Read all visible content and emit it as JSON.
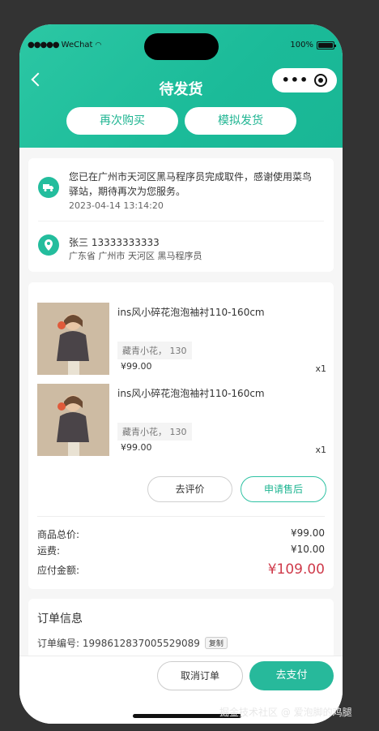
{
  "status_bar": {
    "carrier": "WeChat",
    "battery": "100%"
  },
  "nav": {
    "title": "待发货"
  },
  "header_buttons": {
    "rebuy": "再次购买",
    "mock_ship": "模拟发货"
  },
  "shipping": {
    "message": "您已在广州市天河区黑马程序员完成取件，感谢使用菜鸟驿站，期待再次为您服务。",
    "time": "2023-04-14 13:14:20"
  },
  "address": {
    "name_phone": "张三 13333333333",
    "detail": "广东省 广州市 天河区 黑马程序员"
  },
  "goods": [
    {
      "title": "ins风小碎花泡泡袖衬110-160cm",
      "spec": "藏青小花， 130",
      "price": "¥99.00",
      "qty": "x1"
    },
    {
      "title": "ins风小碎花泡泡袖衬110-160cm",
      "spec": "藏青小花， 130",
      "price": "¥99.00",
      "qty": "x1"
    }
  ],
  "goods_actions": {
    "review": "去评价",
    "after_sale": "申请售后"
  },
  "summary": {
    "goods_total_label": "商品总价:",
    "goods_total": "¥99.00",
    "freight_label": "运费:",
    "freight": "¥10.00",
    "payable_label": "应付金额:",
    "payable": "¥109.00"
  },
  "order": {
    "title": "订单信息",
    "number": "订单编号: 1998612837005529089",
    "copy": "复制"
  },
  "bottom": {
    "cancel": "取消订单",
    "pay": "去支付"
  },
  "watermark": "掘金技术社区 @ 爱泡脚的鸡腿",
  "colors": {
    "brand": "#27b99b",
    "price_red": "#cf3b4b"
  },
  "icons": {
    "back": "chevron-left-icon",
    "more": "more-dots-icon",
    "close": "capsule-close-icon",
    "truck": "truck-icon",
    "location": "location-pin-icon"
  }
}
